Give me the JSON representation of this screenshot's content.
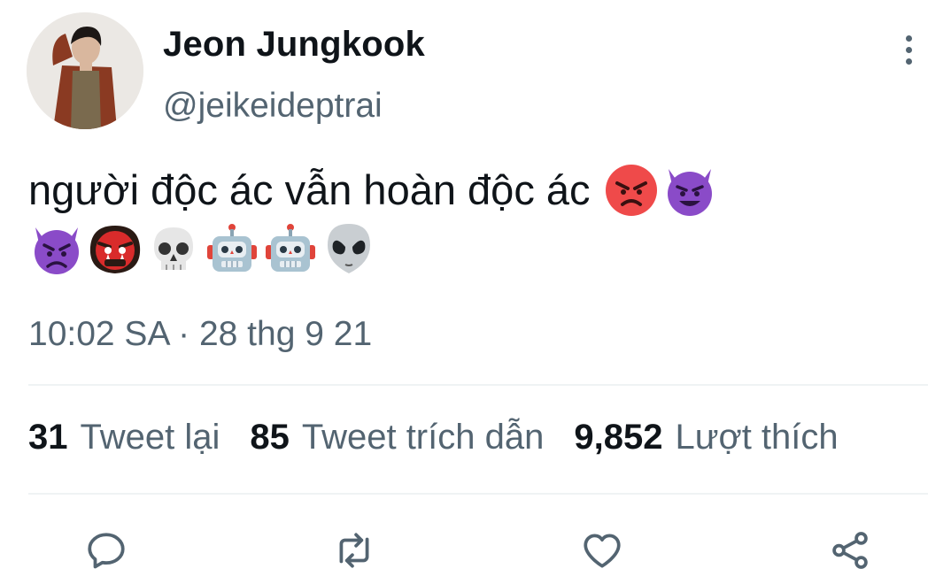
{
  "profile": {
    "display_name": "Jeon Jungkook",
    "handle": "@jeikeideptrai"
  },
  "tweet": {
    "text": "người độc ác vẫn hoàn độc ác",
    "emojis_line1": [
      "angry-face",
      "smiling-face-with-horns"
    ],
    "emojis_line2": [
      "angry-face-with-horns",
      "ogre",
      "skull",
      "robot",
      "robot",
      "alien"
    ],
    "timestamp": "10:02 SA · 28 thg 9 21"
  },
  "stats": {
    "retweets": {
      "count": "31",
      "label": "Tweet lại"
    },
    "quotes": {
      "count": "85",
      "label": "Tweet trích dẫn"
    },
    "likes": {
      "count": "9,852",
      "label": "Lượt thích"
    }
  },
  "actions": [
    "reply-icon",
    "retweet-icon",
    "like-icon",
    "share-icon"
  ],
  "colors": {
    "text_primary": "#0f1419",
    "text_secondary": "#536471",
    "divider": "#eff3f4"
  }
}
